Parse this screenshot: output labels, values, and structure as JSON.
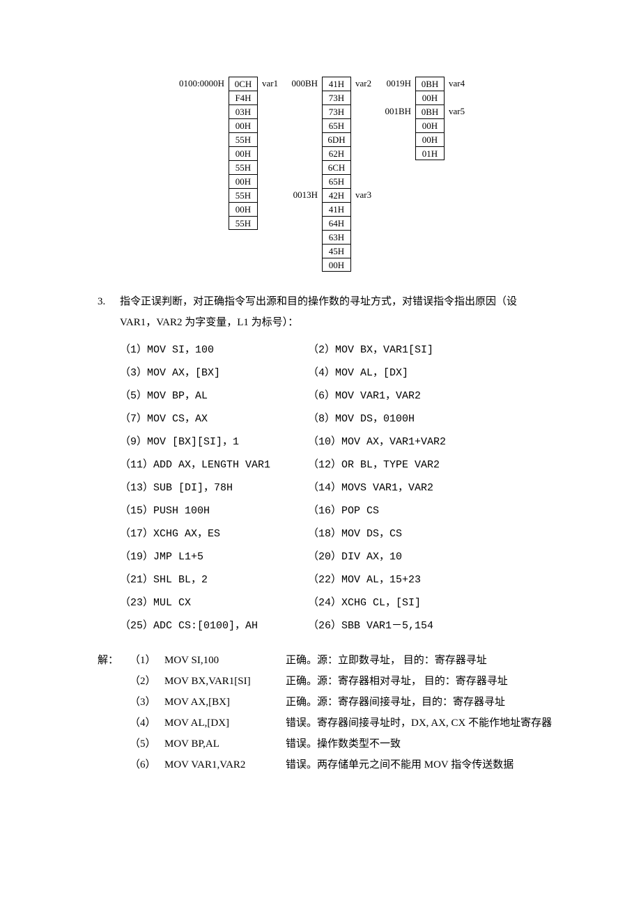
{
  "diagram": {
    "addr_col1_top": "0100:0000H",
    "col1": [
      "0CH",
      "F4H",
      "03H",
      "00H",
      "55H",
      "00H",
      "55H",
      "00H",
      "55H",
      "00H",
      "55H"
    ],
    "col1_right_top": "var1",
    "addr_col2_top": "000BH",
    "addr_col2_mid": "0013H",
    "col2": [
      "41H",
      "73H",
      "73H",
      "65H",
      "6DH",
      "62H",
      "6CH",
      "65H",
      "42H",
      "41H",
      "64H",
      "63H",
      "45H",
      "00H"
    ],
    "col2_right_top": "var2",
    "col2_right_mid": "var3",
    "addr_col3_a": "0019H",
    "addr_col3_b": "001BH",
    "col3": [
      "0BH",
      "00H",
      "0BH",
      "00H",
      "00H",
      "01H"
    ],
    "col3_right_a": "var4",
    "col3_right_b": "var5"
  },
  "question": {
    "num": "3.",
    "lead1": "指令正误判断，对正确指令写出源和目的操作数的寻址方式，对错误指令指出原因（设",
    "lead2": "VAR1，VAR2 为字变量，L1 为标号）：",
    "items": [
      {
        "l": "（1）MOV SI，100",
        "r": "（2）MOV BX，VAR1[SI]"
      },
      {
        "l": "（3）MOV AX，[BX]",
        "r": "（4）MOV AL，[DX]"
      },
      {
        "l": "（5）MOV BP，AL",
        "r": "（6）MOV VAR1，VAR2"
      },
      {
        "l": "（7）MOV CS，AX",
        "r": "（8）MOV DS，0100H"
      },
      {
        "l": "（9）MOV [BX][SI]，1",
        "r": "（10）MOV AX，VAR1+VAR2"
      },
      {
        "l": "（11）ADD AX，LENGTH VAR1",
        "r": "（12）OR BL，TYPE VAR2"
      },
      {
        "l": "（13）SUB [DI]，78H",
        "r": "（14）MOVS VAR1，VAR2"
      },
      {
        "l": "（15）PUSH 100H",
        "r": "（16）POP CS"
      },
      {
        "l": "（17）XCHG AX，ES",
        "r": "（18）MOV DS，CS"
      },
      {
        "l": "（19）JMP L1+5",
        "r": "（20）DIV AX，10"
      },
      {
        "l": "（21）SHL BL，2",
        "r": "（22）MOV AL，15+23"
      },
      {
        "l": "（23）MUL CX",
        "r": "（24）XCHG CL，[SI]"
      },
      {
        "l": "（25）ADC CS:[0100]，AH",
        "r": "（26）SBB VAR1－5,154"
      }
    ]
  },
  "answers": {
    "head": "解：",
    "rows": [
      {
        "n": "（1）",
        "instr": "MOV SI,100",
        "desc": "正确。源：立即数寻址，  目的：寄存器寻址"
      },
      {
        "n": "（2）",
        "instr": "MOV BX,VAR1[SI]",
        "desc": "正确。源：寄存器相对寻址，  目的：寄存器寻址"
      },
      {
        "n": "（3）",
        "instr": "MOV AX,[BX]",
        "desc": "正确。源：寄存器间接寻址，目的：寄存器寻址"
      },
      {
        "n": "（4）",
        "instr": "MOV AL,[DX]",
        "desc": "错误。寄存器间接寻址时，DX, AX, CX 不能作地址寄存器"
      },
      {
        "n": "（5）",
        "instr": "MOV BP,AL",
        "desc": "错误。操作数类型不一致"
      },
      {
        "n": "（6）",
        "instr": "MOV VAR1,VAR2",
        "desc": "错误。两存储单元之间不能用 MOV 指令传送数据"
      }
    ]
  }
}
